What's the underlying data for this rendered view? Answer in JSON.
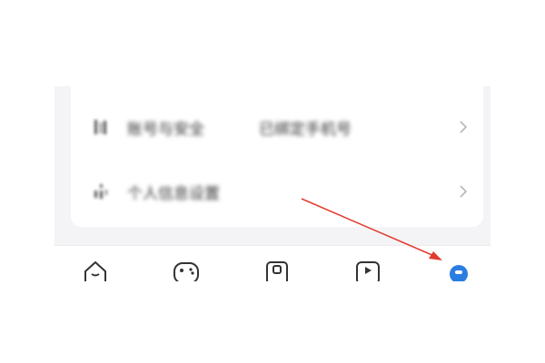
{
  "settings_list": {
    "items": [
      {
        "icon": "user-lock-icon",
        "label": "账号与安全",
        "value": "已绑定手机号"
      },
      {
        "icon": "user-settings-icon",
        "label": "个人信息设置"
      }
    ]
  },
  "tab_bar": {
    "tabs": [
      {
        "icon": "home-icon"
      },
      {
        "icon": "game-icon"
      },
      {
        "icon": "camera-icon"
      },
      {
        "icon": "video-icon"
      },
      {
        "icon": "profile-icon",
        "active": true
      }
    ],
    "active_color": "#2a7de1"
  },
  "annotation": {
    "color": "#e23b2e",
    "points_to": "tab-profile"
  }
}
